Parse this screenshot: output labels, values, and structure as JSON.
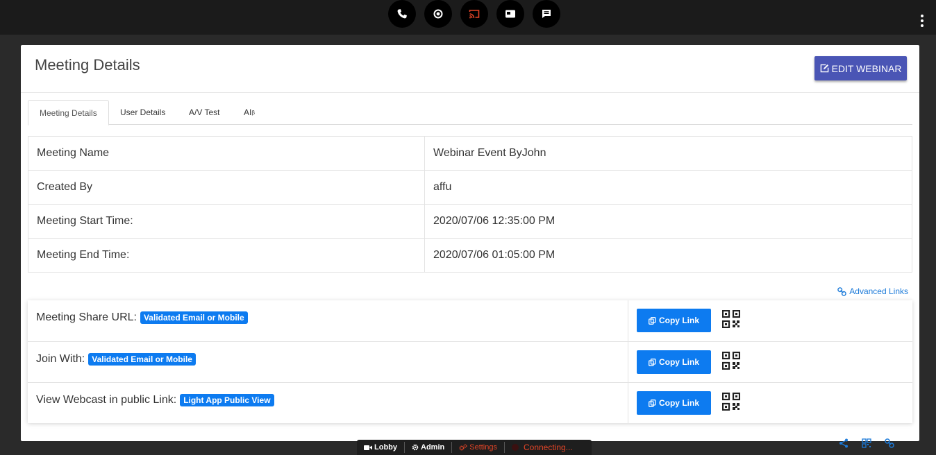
{
  "topbar": {
    "buttons": [
      "phone-icon",
      "record-icon",
      "cast-icon",
      "window-icon",
      "chat-icon"
    ],
    "cast_color": "#e54527"
  },
  "header": {
    "title": "Meeting Details",
    "edit_label": "EDIT WEBINAR"
  },
  "tabs": [
    {
      "label": "Meeting Details",
      "active": true
    },
    {
      "label": "User Details",
      "active": false
    },
    {
      "label": "A/V Test",
      "active": false
    },
    {
      "label": "AI",
      "sup": "β",
      "active": false
    }
  ],
  "details": [
    {
      "key": "Meeting Name",
      "value": "Webinar Event ByJohn"
    },
    {
      "key": "Created By",
      "value": "affu"
    },
    {
      "key": "Meeting Start Time:",
      "value": "2020/07/06 12:35:00 PM"
    },
    {
      "key": "Meeting End Time:",
      "value": "2020/07/06 01:05:00 PM"
    }
  ],
  "advanced_links": "Advanced Links",
  "links": [
    {
      "label": "Meeting Share URL:",
      "badge": "Validated Email or Mobile",
      "copy": "Copy Link"
    },
    {
      "label": "Join With:",
      "badge": "Validated Email or Mobile",
      "copy": "Copy Link"
    },
    {
      "label": "View Webcast in public Link:",
      "badge": "Light App Public View",
      "copy": "Copy Link"
    }
  ],
  "bottom_bar": {
    "lobby": "Lobby",
    "admin": "Admin",
    "settings": "Settings",
    "status": "Connecting..."
  },
  "colors": {
    "primary_button": "#4a55b5",
    "badge_blue": "#0d7bf0",
    "link_blue": "#1b7ad9",
    "alert_red": "#e54527"
  }
}
